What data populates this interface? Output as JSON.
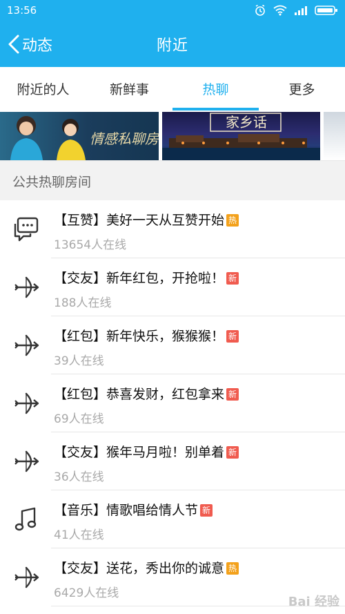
{
  "status_bar": {
    "time": "13:56"
  },
  "header": {
    "back_label": "动态",
    "title": "附近"
  },
  "tabs": [
    {
      "label": "附近的人",
      "active": false
    },
    {
      "label": "新鲜事",
      "active": false
    },
    {
      "label": "热聊",
      "active": true
    },
    {
      "label": "更多",
      "active": false
    }
  ],
  "banners": [
    {
      "text": "情感私聊房"
    },
    {
      "text": "家乡话"
    }
  ],
  "section": {
    "title": "公共热聊房间"
  },
  "rooms": [
    {
      "icon": "chat-bubble-icon",
      "title": "【互赞】美好一天从互赞开始",
      "badge": "热",
      "badge_type": "hot",
      "online": "13654人在线"
    },
    {
      "icon": "cupid-arrow-icon",
      "title": "【交友】新年红包，开抢啦！",
      "badge": "新",
      "badge_type": "new",
      "online": "188人在线"
    },
    {
      "icon": "cupid-arrow-icon",
      "title": "【红包】新年快乐，猴猴猴！",
      "badge": "新",
      "badge_type": "new",
      "online": "39人在线"
    },
    {
      "icon": "cupid-arrow-icon",
      "title": "【红包】恭喜发财，红包拿来",
      "badge": "新",
      "badge_type": "new",
      "online": "69人在线"
    },
    {
      "icon": "cupid-arrow-icon",
      "title": "【交友】猴年马月啦！别单着",
      "badge": "新",
      "badge_type": "new",
      "online": "36人在线"
    },
    {
      "icon": "music-note-icon",
      "title": "【音乐】情歌唱给情人节",
      "badge": "新",
      "badge_type": "new",
      "online": "41人在线"
    },
    {
      "icon": "cupid-arrow-icon",
      "title": "【交友】送花，秀出你的诚意",
      "badge": "热",
      "badge_type": "hot",
      "online": "6429人在线"
    }
  ],
  "watermark": "Bai 经验",
  "colors": {
    "primary": "#1fb0ee",
    "hot_badge": "#f3a11b",
    "new_badge": "#f05b4f"
  }
}
